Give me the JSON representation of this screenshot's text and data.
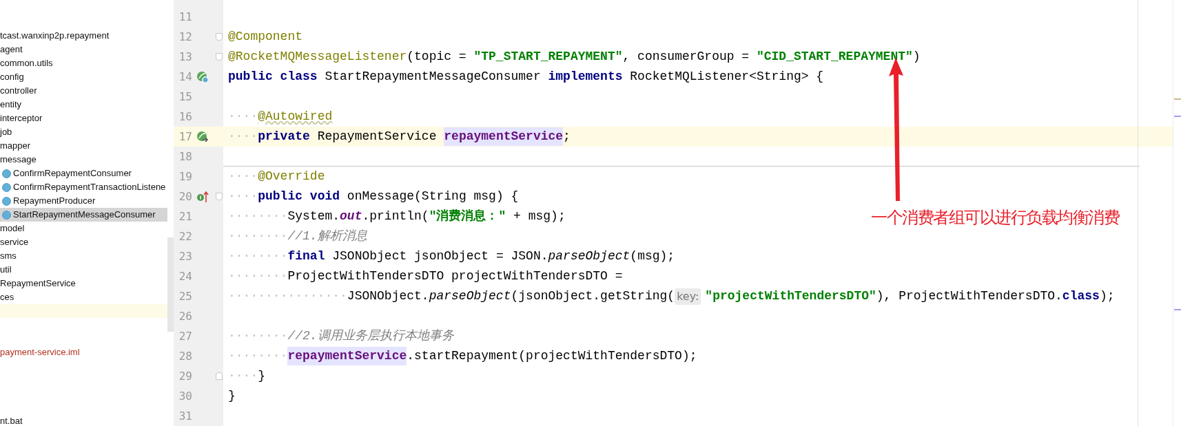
{
  "project_tree": {
    "items": [
      {
        "kind": "package",
        "label": "tcast.wanxinp2p.repayment",
        "selected": false
      },
      {
        "kind": "package",
        "label": "agent",
        "selected": false
      },
      {
        "kind": "package",
        "label": "common.utils",
        "selected": false
      },
      {
        "kind": "package",
        "label": "config",
        "selected": false
      },
      {
        "kind": "package",
        "label": "controller",
        "selected": false
      },
      {
        "kind": "package",
        "label": "entity",
        "selected": false
      },
      {
        "kind": "package",
        "label": "interceptor",
        "selected": false
      },
      {
        "kind": "package",
        "label": "job",
        "selected": false
      },
      {
        "kind": "package",
        "label": "mapper",
        "selected": false
      },
      {
        "kind": "package",
        "label": "message",
        "selected": false
      },
      {
        "kind": "class",
        "label": "ConfirmRepaymentConsumer",
        "selected": false
      },
      {
        "kind": "class",
        "label": "ConfirmRepaymentTransactionListene",
        "selected": false
      },
      {
        "kind": "class",
        "label": "RepaymentProducer",
        "selected": false
      },
      {
        "kind": "class",
        "label": "StartRepaymentMessageConsumer",
        "selected": true
      },
      {
        "kind": "package",
        "label": "model",
        "selected": false
      },
      {
        "kind": "package",
        "label": "service",
        "selected": false
      },
      {
        "kind": "package",
        "label": "sms",
        "selected": false
      },
      {
        "kind": "package",
        "label": "util",
        "selected": false
      },
      {
        "kind": "package",
        "label": "RepaymentService",
        "selected": false
      },
      {
        "kind": "package",
        "label": "ces",
        "selected": false
      },
      {
        "kind": "blank",
        "selected": true
      },
      {
        "kind": "blank",
        "selected": false
      },
      {
        "kind": "blank",
        "selected": false
      },
      {
        "kind": "module-file",
        "label": "payment-service.iml",
        "selected": false
      },
      {
        "kind": "blank",
        "selected": false
      },
      {
        "kind": "blank",
        "selected": false
      },
      {
        "kind": "blank",
        "selected": false
      },
      {
        "kind": "blank",
        "selected": false
      },
      {
        "kind": "file",
        "label": "nt.bat",
        "selected": false
      }
    ]
  },
  "editor": {
    "lines": [
      {
        "number": "11",
        "current": false
      },
      {
        "number": "12",
        "current": false,
        "fold": {
          "kind": "start"
        },
        "tokens": [
          {
            "kind": "annotation",
            "text": "@Component"
          }
        ]
      },
      {
        "number": "13",
        "current": false,
        "fold": {
          "kind": "start"
        },
        "tokens": [
          {
            "kind": "annotation",
            "text": "@RocketMQMessageListener"
          },
          {
            "kind": "plain",
            "text": "(topic = "
          },
          {
            "kind": "string",
            "text": "\"TP_START_REPAYMENT\""
          },
          {
            "kind": "plain",
            "text": ", consumerGroup = "
          },
          {
            "kind": "string",
            "text": "\"CID_START_REPAYMENT\""
          },
          {
            "kind": "plain",
            "text": ")"
          }
        ]
      },
      {
        "number": "14",
        "current": false,
        "gutter_icon": {
          "kind": "bean-class"
        },
        "tokens": [
          {
            "kind": "keyword",
            "text": "public class"
          },
          {
            "kind": "plain",
            "text": " StartRepaymentMessageConsumer "
          },
          {
            "kind": "keyword",
            "text": "implements"
          },
          {
            "kind": "plain",
            "text": " RocketMQListener<String> {"
          }
        ]
      },
      {
        "number": "15",
        "current": false
      },
      {
        "number": "16",
        "current": false,
        "tokens": [
          {
            "kind": "whitespace",
            "text": "····"
          },
          {
            "kind": "annotation",
            "text": "@Autowired"
          }
        ]
      },
      {
        "number": "17",
        "current": true,
        "gutter_icon": {
          "kind": "bean-inject"
        },
        "tokens": [
          {
            "kind": "whitespace",
            "text": "····"
          },
          {
            "kind": "keyword",
            "text": "private"
          },
          {
            "kind": "plain",
            "text": " RepaymentService "
          },
          {
            "kind": "field",
            "text": "repaymentService"
          },
          {
            "kind": "plain",
            "text": ";"
          }
        ]
      },
      {
        "number": "18",
        "current": false,
        "separator_after": true
      },
      {
        "number": "19",
        "current": false,
        "tokens": [
          {
            "kind": "whitespace",
            "text": "····"
          },
          {
            "kind": "annotation",
            "text": "@Override"
          }
        ]
      },
      {
        "number": "20",
        "current": false,
        "gutter_icon": {
          "kind": "implements-override"
        },
        "fold": {
          "kind": "start"
        },
        "tokens": [
          {
            "kind": "whitespace",
            "text": "····"
          },
          {
            "kind": "keyword",
            "text": "public void"
          },
          {
            "kind": "plain",
            "text": " onMessage(String msg) {"
          }
        ]
      },
      {
        "number": "21",
        "current": false,
        "tokens": [
          {
            "kind": "whitespace",
            "text": "········"
          },
          {
            "kind": "plain",
            "text": "System."
          },
          {
            "kind": "static",
            "text": "out"
          },
          {
            "kind": "plain",
            "text": ".println("
          },
          {
            "kind": "string",
            "text": "\"消费消息：\""
          },
          {
            "kind": "plain",
            "text": " + msg);"
          }
        ]
      },
      {
        "number": "22",
        "current": false,
        "tokens": [
          {
            "kind": "whitespace",
            "text": "········"
          },
          {
            "kind": "comment",
            "text": "//1.解析消息"
          }
        ]
      },
      {
        "number": "23",
        "current": false,
        "tokens": [
          {
            "kind": "whitespace",
            "text": "········"
          },
          {
            "kind": "keyword",
            "text": "final"
          },
          {
            "kind": "plain",
            "text": " JSONObject jsonObject = JSON."
          },
          {
            "kind": "method-static",
            "text": "parseObject"
          },
          {
            "kind": "plain",
            "text": "(msg);"
          }
        ]
      },
      {
        "number": "24",
        "current": false,
        "tokens": [
          {
            "kind": "whitespace",
            "text": "········"
          },
          {
            "kind": "plain",
            "text": "ProjectWithTendersDTO projectWithTendersDTO ="
          }
        ]
      },
      {
        "number": "25",
        "current": false,
        "tokens": [
          {
            "kind": "whitespace",
            "text": "················"
          },
          {
            "kind": "plain",
            "text": "JSONObject."
          },
          {
            "kind": "method-static",
            "text": "parseObject"
          },
          {
            "kind": "plain",
            "text": "(jsonObject.getString("
          },
          {
            "kind": "hint",
            "text": "key:"
          },
          {
            "kind": "string",
            "text": "\"projectWithTendersDTO\""
          },
          {
            "kind": "plain",
            "text": "), ProjectWithTendersDTO."
          },
          {
            "kind": "keyword",
            "text": "class"
          },
          {
            "kind": "plain",
            "text": ");"
          }
        ]
      },
      {
        "number": "26",
        "current": false
      },
      {
        "number": "27",
        "current": false,
        "tokens": [
          {
            "kind": "whitespace",
            "text": "········"
          },
          {
            "kind": "comment",
            "text": "//2.调用业务层执行本地事务"
          }
        ]
      },
      {
        "number": "28",
        "current": false,
        "tokens": [
          {
            "kind": "whitespace",
            "text": "········"
          },
          {
            "kind": "field",
            "text": "repaymentService"
          },
          {
            "kind": "plain",
            "text": ".startRepayment(projectWithTendersDTO);"
          }
        ]
      },
      {
        "number": "29",
        "current": false,
        "fold": {
          "kind": "end"
        },
        "tokens": [
          {
            "kind": "whitespace",
            "text": "····"
          },
          {
            "kind": "plain",
            "text": "}"
          }
        ]
      },
      {
        "number": "30",
        "current": false,
        "tokens": [
          {
            "kind": "plain",
            "text": "}"
          }
        ]
      },
      {
        "number": "31",
        "current": false
      }
    ]
  },
  "annotation": {
    "text": "一个消费者组可以进行负载均衡消费"
  }
}
